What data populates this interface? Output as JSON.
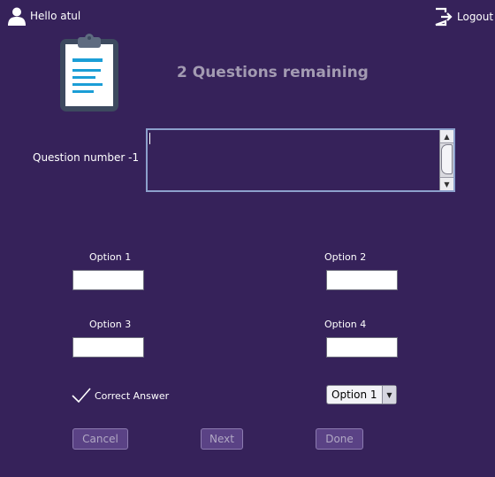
{
  "header": {
    "greeting": "Hello atul",
    "logout_label": "Logout",
    "user_icon": "user-icon",
    "logout_icon": "logout-icon"
  },
  "main": {
    "illustration": "clipboard-icon",
    "remaining_text": "2 Questions remaining",
    "question_label": "Question number -1",
    "question_value": ""
  },
  "options": [
    {
      "label": "Option 1",
      "value": ""
    },
    {
      "label": "Option 2",
      "value": ""
    },
    {
      "label": "Option 3",
      "value": ""
    },
    {
      "label": "Option 4",
      "value": ""
    }
  ],
  "answer": {
    "correct_label": "Correct Answer",
    "check_icon": "check-icon",
    "selected": "Option 1"
  },
  "actions": {
    "cancel": "Cancel",
    "next": "Next",
    "done": "Done"
  },
  "colors": {
    "background": "#36225a",
    "heading": "#a39bb2",
    "button_bg": "#5a4285",
    "button_text": "#b1a8c4",
    "textarea_border": "#8ca0cc"
  }
}
